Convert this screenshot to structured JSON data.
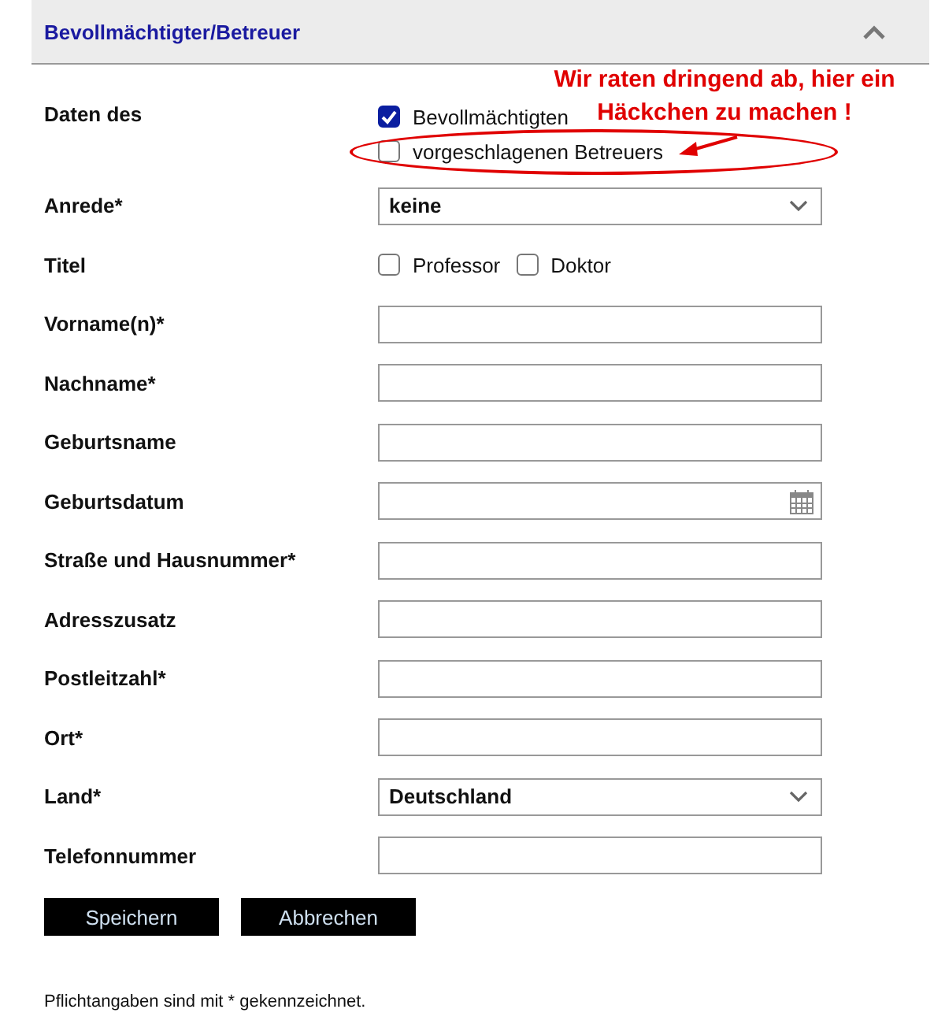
{
  "section": {
    "title": "Bevollmächtigter/Betreuer",
    "expanded": true
  },
  "annotation": {
    "lines": [
      "Wir raten dringend ab, hier ein",
      "Häckchen zu machen !"
    ]
  },
  "fields": [
    {
      "kind": "checkbox-group",
      "label": "Daten des",
      "options": [
        {
          "label": "Bevollmächtigten",
          "checked": true,
          "highlighted": false
        },
        {
          "label": "vorgeschlagenen Betreuers",
          "checked": false,
          "highlighted": true
        }
      ]
    },
    {
      "kind": "select",
      "label": "Anrede*",
      "value": "keine"
    },
    {
      "kind": "checkbox-row",
      "label": "Titel",
      "options": [
        {
          "label": "Professor",
          "checked": false
        },
        {
          "label": "Doktor",
          "checked": false
        }
      ]
    },
    {
      "kind": "text",
      "label": "Vorname(n)*"
    },
    {
      "kind": "text",
      "label": "Nachname*"
    },
    {
      "kind": "text",
      "label": "Geburtsname"
    },
    {
      "kind": "date",
      "label": "Geburtsdatum"
    },
    {
      "kind": "text",
      "label": "Straße und Hausnummer*"
    },
    {
      "kind": "text",
      "label": "Adresszusatz"
    },
    {
      "kind": "text",
      "label": "Postleitzahl*"
    },
    {
      "kind": "text",
      "label": "Ort*"
    },
    {
      "kind": "select",
      "label": "Land*",
      "value": "Deutschland"
    },
    {
      "kind": "text",
      "label": "Telefonnummer"
    }
  ],
  "buttons": [
    "Speichern",
    "Abbrechen"
  ],
  "footnote": "Pflichtangaben sind mit * gekennzeichnet."
}
